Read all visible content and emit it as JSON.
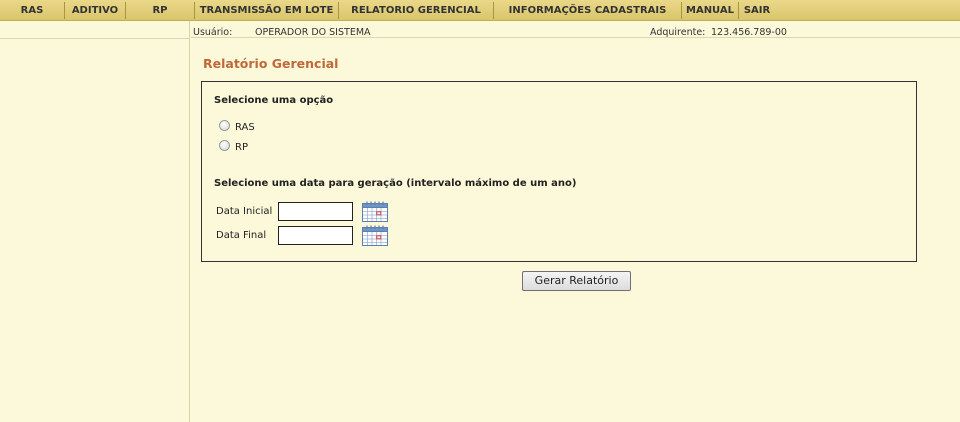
{
  "menu": {
    "items": [
      {
        "label": "RAS"
      },
      {
        "label": "ADITIVO"
      },
      {
        "label": "RP"
      },
      {
        "label": "TRANSMISSÃO EM LOTE"
      },
      {
        "label": "RELATORIO GERENCIAL"
      },
      {
        "label": "INFORMAÇÕES CADASTRAIS"
      },
      {
        "label": "MANUAL"
      },
      {
        "label": "SAIR"
      }
    ]
  },
  "info": {
    "user_label": "Usuário:",
    "user_value": "OPERADOR DO SISTEMA",
    "acquirer_label": "Adquirente:",
    "acquirer_value": "123.456.789-00"
  },
  "page": {
    "title": "Relatório Gerencial"
  },
  "form": {
    "option_heading": "Selecione uma opção",
    "options": [
      {
        "label": "RAS",
        "selected": false
      },
      {
        "label": "RP",
        "selected": false
      }
    ],
    "date_heading": "Selecione uma data para geração (intervalo máximo de um ano)",
    "start_date": {
      "label": "Data Inicial",
      "value": ""
    },
    "end_date": {
      "label": "Data Final",
      "value": ""
    },
    "submit_label": "Gerar Relatório"
  },
  "icons": {
    "calendar": "calendar-icon"
  },
  "colors": {
    "background": "#fbf9da",
    "menu_bar": "#e2cf78",
    "title": "#c0683a"
  }
}
